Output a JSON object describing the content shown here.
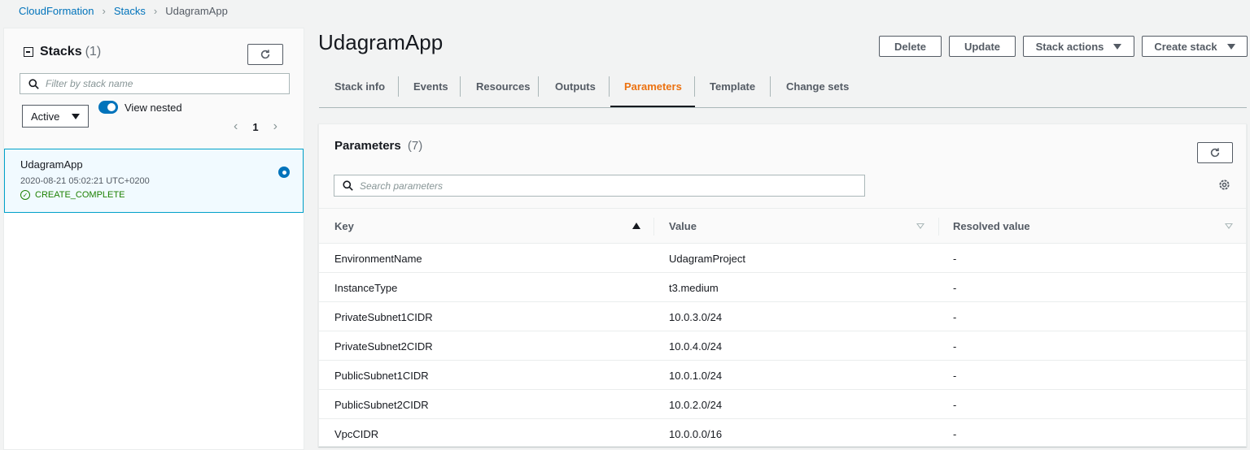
{
  "breadcrumb": {
    "items": [
      "CloudFormation",
      "Stacks",
      "UdagramApp"
    ]
  },
  "left_panel": {
    "title": "Stacks",
    "count": "(1)",
    "search_placeholder": "Filter by stack name",
    "filter_value": "Active",
    "toggle_label": "View nested",
    "toggle_on": true,
    "page_number": "1",
    "stacks": [
      {
        "name": "UdagramApp",
        "timestamp": "2020-08-21 05:02:21 UTC+0200",
        "status": "CREATE_COMPLETE",
        "selected": true
      }
    ]
  },
  "main": {
    "title": "UdagramApp",
    "actions": {
      "delete": "Delete",
      "update": "Update",
      "stack_actions": "Stack actions",
      "create_stack": "Create stack"
    },
    "tabs": [
      {
        "label": "Stack info",
        "active": false
      },
      {
        "label": "Events",
        "active": false
      },
      {
        "label": "Resources",
        "active": false
      },
      {
        "label": "Outputs",
        "active": false
      },
      {
        "label": "Parameters",
        "active": true
      },
      {
        "label": "Template",
        "active": false
      },
      {
        "label": "Change sets",
        "active": false
      }
    ],
    "parameters": {
      "title": "Parameters",
      "count": "(7)",
      "search_placeholder": "Search parameters",
      "columns": [
        "Key",
        "Value",
        "Resolved value"
      ],
      "rows": [
        {
          "key": "EnvironmentName",
          "value": "UdagramProject",
          "resolved": "-"
        },
        {
          "key": "InstanceType",
          "value": "t3.medium",
          "resolved": "-"
        },
        {
          "key": "PrivateSubnet1CIDR",
          "value": "10.0.3.0/24",
          "resolved": "-"
        },
        {
          "key": "PrivateSubnet2CIDR",
          "value": "10.0.4.0/24",
          "resolved": "-"
        },
        {
          "key": "PublicSubnet1CIDR",
          "value": "10.0.1.0/24",
          "resolved": "-"
        },
        {
          "key": "PublicSubnet2CIDR",
          "value": "10.0.2.0/24",
          "resolved": "-"
        },
        {
          "key": "VpcCIDR",
          "value": "10.0.0.0/16",
          "resolved": "-"
        }
      ]
    }
  },
  "colors": {
    "link": "#0073bb",
    "active_tab": "#ec7211",
    "success": "#1d8102",
    "selected_border": "#00a1c9"
  }
}
